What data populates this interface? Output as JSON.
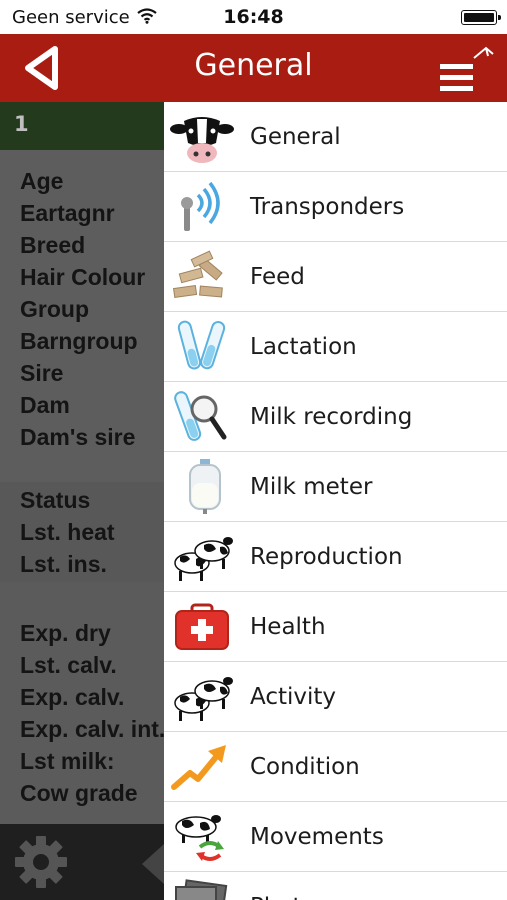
{
  "status_bar": {
    "carrier": "Geen service",
    "time": "16:48"
  },
  "header": {
    "title": "General"
  },
  "left_panel": {
    "animal_id": "1",
    "group1": [
      "Age",
      "Eartagnr",
      "Breed",
      "Hair Colour",
      "Group",
      "Barngroup",
      "Sire",
      "Dam",
      "Dam's sire"
    ],
    "group2": [
      "Status",
      "Lst. heat",
      "Lst. ins."
    ],
    "group3": [
      "Exp. dry",
      "Lst. calv.",
      "Exp. calv.",
      "Exp. calv. int.",
      "Lst milk:",
      "Cow grade"
    ]
  },
  "menu": {
    "items": [
      {
        "label": "General",
        "icon": "cow-head-icon"
      },
      {
        "label": "Transponders",
        "icon": "transponder-icon"
      },
      {
        "label": "Feed",
        "icon": "feed-icon"
      },
      {
        "label": "Lactation",
        "icon": "test-tubes-icon"
      },
      {
        "label": "Milk recording",
        "icon": "magnifier-tube-icon"
      },
      {
        "label": "Milk meter",
        "icon": "milk-meter-icon"
      },
      {
        "label": "Reproduction",
        "icon": "cows-icon"
      },
      {
        "label": "Health",
        "icon": "first-aid-kit-icon"
      },
      {
        "label": "Activity",
        "icon": "cows-icon"
      },
      {
        "label": "Condition",
        "icon": "trend-arrow-icon"
      },
      {
        "label": "Movements",
        "icon": "cow-movement-icon"
      },
      {
        "label": "Photo",
        "icon": "photo-icon"
      }
    ]
  },
  "colors": {
    "header": "#a81c12",
    "left_panel": "#595959",
    "left_topbar": "#233a1d"
  }
}
